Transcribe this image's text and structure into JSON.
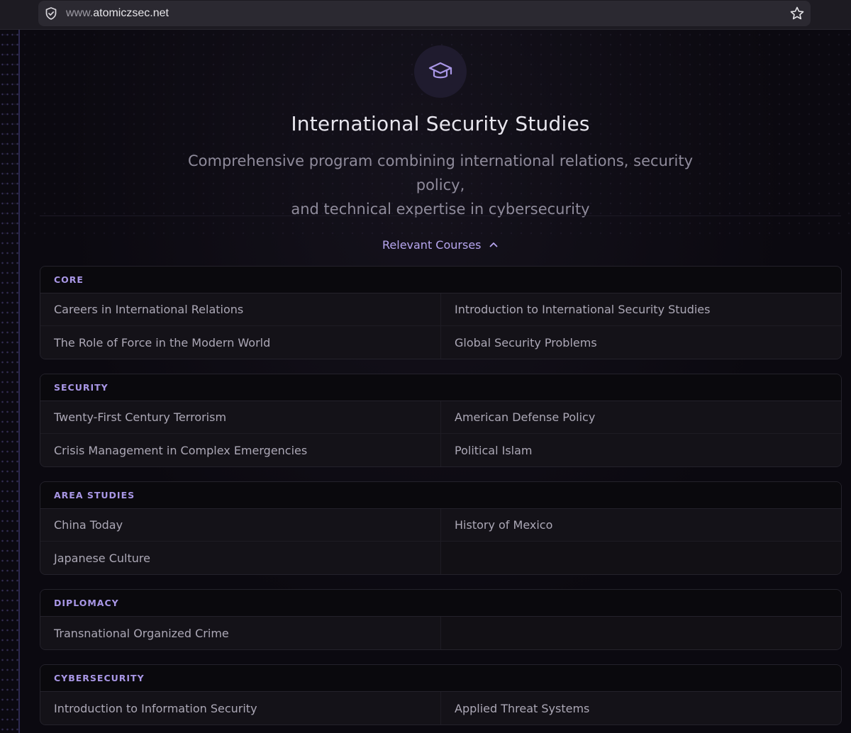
{
  "browser": {
    "url_prefix": "www.",
    "url_host": "atomiczsec.net"
  },
  "program": {
    "icon": "graduation-cap-icon",
    "title": "International Security Studies",
    "subtitle_line1": "Comprehensive program combining international relations, security policy,",
    "subtitle_line2": "and technical expertise in cybersecurity",
    "courses_toggle_label": "Relevant Courses"
  },
  "colors": {
    "accent": "#a997e6",
    "background": "#0b0910"
  },
  "groups": [
    {
      "name": "CORE",
      "courses": [
        "Careers in International Relations",
        "Introduction to International Security Studies",
        "The Role of Force in the Modern World",
        "Global Security Problems"
      ]
    },
    {
      "name": "SECURITY",
      "courses": [
        "Twenty-First Century Terrorism",
        "American Defense Policy",
        "Crisis Management in Complex Emergencies",
        "Political Islam"
      ]
    },
    {
      "name": "AREA STUDIES",
      "courses": [
        "China Today",
        "History of Mexico",
        "Japanese Culture"
      ]
    },
    {
      "name": "DIPLOMACY",
      "courses": [
        "Transnational Organized Crime"
      ]
    },
    {
      "name": "CYBERSECURITY",
      "courses": [
        "Introduction to Information Security",
        "Applied Threat Systems"
      ]
    }
  ]
}
